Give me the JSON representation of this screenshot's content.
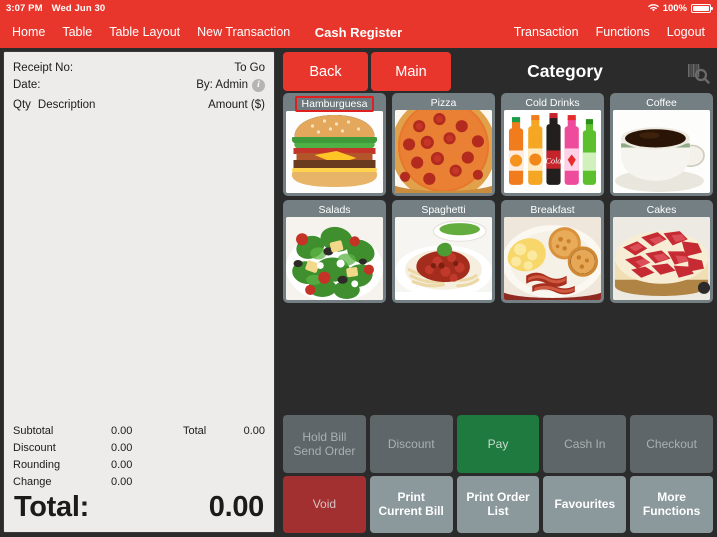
{
  "statusbar": {
    "time": "3:07 PM",
    "date": "Wed Jun 30",
    "battery_percent": "100%",
    "wifi_icon": "wifi-icon",
    "battery_icon": "battery-icon"
  },
  "navbar": {
    "title": "Cash Register",
    "left_items": [
      {
        "label": "Home"
      },
      {
        "label": "Table"
      },
      {
        "label": "Table Layout"
      },
      {
        "label": "New Transaction"
      }
    ],
    "right_items": [
      {
        "label": "Transaction"
      },
      {
        "label": "Functions"
      },
      {
        "label": "Logout"
      }
    ]
  },
  "receipt": {
    "receipt_no_label": "Receipt No:",
    "receipt_no_value": "To Go",
    "date_label": "Date:",
    "date_value": "By: Admin",
    "info_icon": "info-icon",
    "col_qty": "Qty",
    "col_description": "Description",
    "col_amount": "Amount ($)",
    "items": [],
    "totals": [
      {
        "label": "Subtotal",
        "value": "0.00",
        "label2": "Total",
        "value2": "0.00"
      },
      {
        "label": "Discount",
        "value": "0.00",
        "label2": "",
        "value2": ""
      },
      {
        "label": "Rounding",
        "value": "0.00",
        "label2": "",
        "value2": ""
      },
      {
        "label": "Change",
        "value": "0.00",
        "label2": "",
        "value2": ""
      }
    ],
    "grand_total_label": "Total:",
    "grand_total_value": "0.00"
  },
  "category_header": {
    "back_label": "Back",
    "main_label": "Main",
    "title": "Category",
    "scan_icon": "barcode-scan-search-icon"
  },
  "categories": [
    {
      "label": "Hamburguesa",
      "image": "hamburger-photo",
      "selected": true
    },
    {
      "label": "Pizza",
      "image": "pepperoni-pizza-photo",
      "selected": false
    },
    {
      "label": "Cold Drinks",
      "image": "soda-bottles-photo",
      "selected": false
    },
    {
      "label": "Coffee",
      "image": "coffee-cup-photo",
      "selected": false
    },
    {
      "label": "Salads",
      "image": "garden-salad-photo",
      "selected": false
    },
    {
      "label": "Spaghetti",
      "image": "spaghetti-bolognese-photo",
      "selected": false
    },
    {
      "label": "Breakfast",
      "image": "breakfast-plate-photo",
      "selected": false
    },
    {
      "label": "Cakes",
      "image": "strawberry-cheesecake-photo",
      "selected": false
    }
  ],
  "actions": [
    {
      "label": "Hold Bill\nSend Order",
      "style": "disabled"
    },
    {
      "label": "Discount",
      "style": "disabled"
    },
    {
      "label": "Pay",
      "style": "pay"
    },
    {
      "label": "Cash In",
      "style": "disabled"
    },
    {
      "label": "Checkout",
      "style": "disabled"
    },
    {
      "label": "Void",
      "style": "void"
    },
    {
      "label": "Print\nCurrent Bill",
      "style": "norm"
    },
    {
      "label": "Print Order\nList",
      "style": "norm"
    },
    {
      "label": "Favourites",
      "style": "norm"
    },
    {
      "label": "More\nFunctions",
      "style": "norm"
    }
  ],
  "colors": {
    "brand_red": "#e8362d",
    "pay_green": "#1f7a3f",
    "void_red": "#a33030",
    "panel_bg": "#2b2b2b",
    "tile_bg": "#737f82",
    "receipt_bg": "#eeecea",
    "selection_border": "#e02020"
  }
}
